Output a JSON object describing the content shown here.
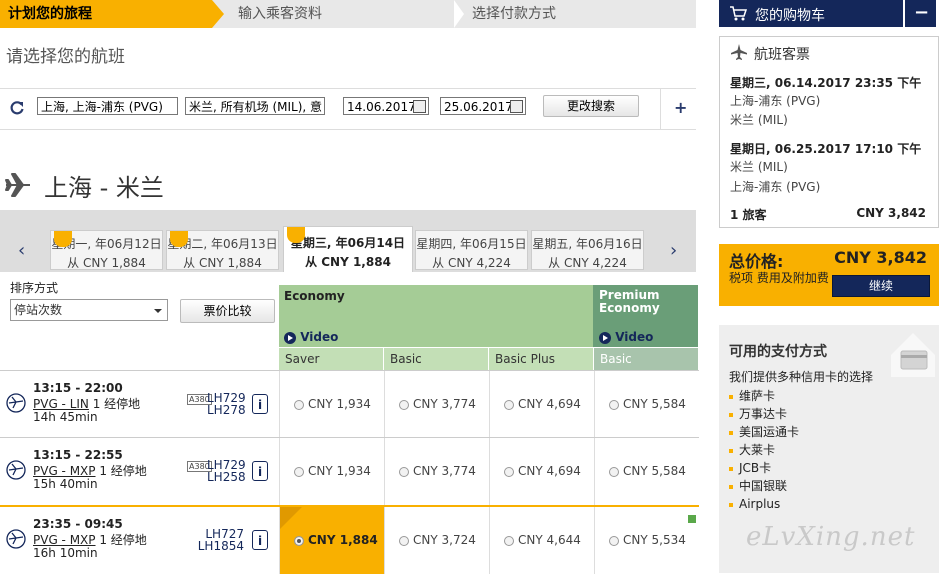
{
  "steps": [
    "计划您的旅程",
    "输入乘客资料",
    "选择付款方式"
  ],
  "page_heading": "请选择您的航班",
  "search": {
    "from": "上海, 上海-浦东 (PVG)",
    "to": "米兰, 所有机场 (MIL), 意",
    "depart_date": "14.06.2017",
    "return_date": "25.06.2017",
    "modify_label": "更改搜索",
    "plus_label": "+"
  },
  "route_title": "上海 - 米兰",
  "dates": [
    {
      "day": "星期一, 年06月12日",
      "price": "从 CNY 1,884"
    },
    {
      "day": "星期二, 年06月13日",
      "price": "从 CNY 1,884"
    },
    {
      "day": "星期三, 年06月14日",
      "price": "从 CNY 1,884"
    },
    {
      "day": "星期四, 年06月15日",
      "price": "从 CNY 4,224"
    },
    {
      "day": "星期五, 年06月16日",
      "price": "从 CNY 4,224"
    }
  ],
  "sort": {
    "label": "排序方式",
    "value": "停站次数",
    "compare": "票价比较"
  },
  "cabins": {
    "economy": "Economy",
    "premium_line1": "Premium",
    "premium_line2": "Economy",
    "video": "Video"
  },
  "fare_types": [
    "Saver",
    "Basic",
    "Basic Plus",
    "Basic"
  ],
  "flights": [
    {
      "time": "13:15 - 22:00",
      "route": "PVG - LIN",
      "stops": "1 经停地",
      "duration": "14h 45min",
      "flight1": "LH729",
      "flight2": "LH278",
      "prices": [
        "CNY 1,934",
        "CNY 3,774",
        "CNY 4,694",
        "CNY 5,584"
      ]
    },
    {
      "time": "13:15 - 22:55",
      "route": "PVG - MXP",
      "stops": "1 经停地",
      "duration": "15h 40min",
      "flight1": "LH729",
      "flight2": "LH258",
      "prices": [
        "CNY 1,934",
        "CNY 3,774",
        "CNY 4,694",
        "CNY 5,584"
      ]
    },
    {
      "time": "23:35 - 09:45",
      "route": "PVG - MXP",
      "stops": "1 经停地",
      "duration": "16h 10min",
      "flight1": "LH727",
      "flight2": "LH1854",
      "prices": [
        "CNY 1,884",
        "CNY 3,724",
        "CNY 4,644",
        "CNY 5,534"
      ]
    }
  ],
  "aircraft_badge": "A380",
  "info_icon": "i",
  "cart": {
    "title": "您的购物车",
    "collapse": "−"
  },
  "ticket": {
    "title": "航班客票",
    "out_date": "星期三, 06.14.2017 23:35 下午",
    "out_from": "上海-浦东 (PVG)",
    "out_to": "米兰 (MIL)",
    "ret_date": "星期日, 06.25.2017 17:10 下午",
    "ret_from": "米兰 (MIL)",
    "ret_to": "上海-浦东 (PVG)",
    "pax": "1 旅客",
    "pax_price": "CNY 3,842"
  },
  "total": {
    "label": "总价格:",
    "value": "CNY 3,842",
    "note": "税项 费用及附加费",
    "continue": "继续"
  },
  "payment": {
    "title": "可用的支付方式",
    "subtitle": "我们提供多种信用卡的选择",
    "methods": [
      "维萨卡",
      "万事达卡",
      "美国运通卡",
      "大莱卡",
      "JCB卡",
      "中国银联",
      "Airplus"
    ]
  },
  "watermark": "eLvXing.net",
  "colors": {
    "brand_yellow": "#f9b000",
    "navy": "#14275a",
    "economy_green": "#a5cc96",
    "premium_green": "#6a9e78"
  }
}
